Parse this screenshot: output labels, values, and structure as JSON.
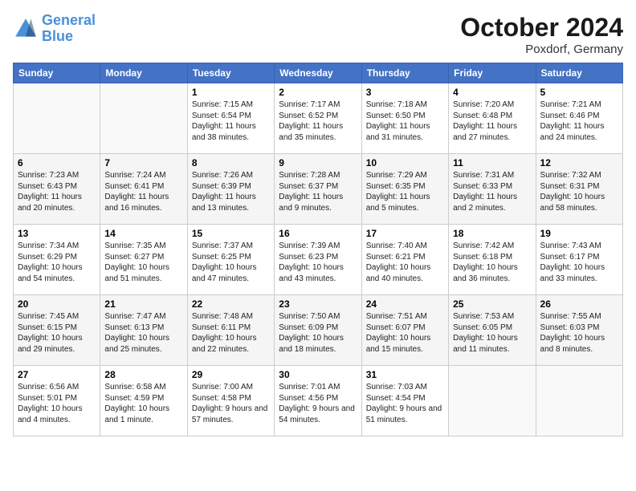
{
  "logo": {
    "line1": "General",
    "line2": "Blue"
  },
  "title": "October 2024",
  "subtitle": "Poxdorf, Germany",
  "days_of_week": [
    "Sunday",
    "Monday",
    "Tuesday",
    "Wednesday",
    "Thursday",
    "Friday",
    "Saturday"
  ],
  "weeks": [
    [
      {
        "day": "",
        "sunrise": "",
        "sunset": "",
        "daylight": ""
      },
      {
        "day": "",
        "sunrise": "",
        "sunset": "",
        "daylight": ""
      },
      {
        "day": "1",
        "sunrise": "Sunrise: 7:15 AM",
        "sunset": "Sunset: 6:54 PM",
        "daylight": "Daylight: 11 hours and 38 minutes."
      },
      {
        "day": "2",
        "sunrise": "Sunrise: 7:17 AM",
        "sunset": "Sunset: 6:52 PM",
        "daylight": "Daylight: 11 hours and 35 minutes."
      },
      {
        "day": "3",
        "sunrise": "Sunrise: 7:18 AM",
        "sunset": "Sunset: 6:50 PM",
        "daylight": "Daylight: 11 hours and 31 minutes."
      },
      {
        "day": "4",
        "sunrise": "Sunrise: 7:20 AM",
        "sunset": "Sunset: 6:48 PM",
        "daylight": "Daylight: 11 hours and 27 minutes."
      },
      {
        "day": "5",
        "sunrise": "Sunrise: 7:21 AM",
        "sunset": "Sunset: 6:46 PM",
        "daylight": "Daylight: 11 hours and 24 minutes."
      }
    ],
    [
      {
        "day": "6",
        "sunrise": "Sunrise: 7:23 AM",
        "sunset": "Sunset: 6:43 PM",
        "daylight": "Daylight: 11 hours and 20 minutes."
      },
      {
        "day": "7",
        "sunrise": "Sunrise: 7:24 AM",
        "sunset": "Sunset: 6:41 PM",
        "daylight": "Daylight: 11 hours and 16 minutes."
      },
      {
        "day": "8",
        "sunrise": "Sunrise: 7:26 AM",
        "sunset": "Sunset: 6:39 PM",
        "daylight": "Daylight: 11 hours and 13 minutes."
      },
      {
        "day": "9",
        "sunrise": "Sunrise: 7:28 AM",
        "sunset": "Sunset: 6:37 PM",
        "daylight": "Daylight: 11 hours and 9 minutes."
      },
      {
        "day": "10",
        "sunrise": "Sunrise: 7:29 AM",
        "sunset": "Sunset: 6:35 PM",
        "daylight": "Daylight: 11 hours and 5 minutes."
      },
      {
        "day": "11",
        "sunrise": "Sunrise: 7:31 AM",
        "sunset": "Sunset: 6:33 PM",
        "daylight": "Daylight: 11 hours and 2 minutes."
      },
      {
        "day": "12",
        "sunrise": "Sunrise: 7:32 AM",
        "sunset": "Sunset: 6:31 PM",
        "daylight": "Daylight: 10 hours and 58 minutes."
      }
    ],
    [
      {
        "day": "13",
        "sunrise": "Sunrise: 7:34 AM",
        "sunset": "Sunset: 6:29 PM",
        "daylight": "Daylight: 10 hours and 54 minutes."
      },
      {
        "day": "14",
        "sunrise": "Sunrise: 7:35 AM",
        "sunset": "Sunset: 6:27 PM",
        "daylight": "Daylight: 10 hours and 51 minutes."
      },
      {
        "day": "15",
        "sunrise": "Sunrise: 7:37 AM",
        "sunset": "Sunset: 6:25 PM",
        "daylight": "Daylight: 10 hours and 47 minutes."
      },
      {
        "day": "16",
        "sunrise": "Sunrise: 7:39 AM",
        "sunset": "Sunset: 6:23 PM",
        "daylight": "Daylight: 10 hours and 43 minutes."
      },
      {
        "day": "17",
        "sunrise": "Sunrise: 7:40 AM",
        "sunset": "Sunset: 6:21 PM",
        "daylight": "Daylight: 10 hours and 40 minutes."
      },
      {
        "day": "18",
        "sunrise": "Sunrise: 7:42 AM",
        "sunset": "Sunset: 6:18 PM",
        "daylight": "Daylight: 10 hours and 36 minutes."
      },
      {
        "day": "19",
        "sunrise": "Sunrise: 7:43 AM",
        "sunset": "Sunset: 6:17 PM",
        "daylight": "Daylight: 10 hours and 33 minutes."
      }
    ],
    [
      {
        "day": "20",
        "sunrise": "Sunrise: 7:45 AM",
        "sunset": "Sunset: 6:15 PM",
        "daylight": "Daylight: 10 hours and 29 minutes."
      },
      {
        "day": "21",
        "sunrise": "Sunrise: 7:47 AM",
        "sunset": "Sunset: 6:13 PM",
        "daylight": "Daylight: 10 hours and 25 minutes."
      },
      {
        "day": "22",
        "sunrise": "Sunrise: 7:48 AM",
        "sunset": "Sunset: 6:11 PM",
        "daylight": "Daylight: 10 hours and 22 minutes."
      },
      {
        "day": "23",
        "sunrise": "Sunrise: 7:50 AM",
        "sunset": "Sunset: 6:09 PM",
        "daylight": "Daylight: 10 hours and 18 minutes."
      },
      {
        "day": "24",
        "sunrise": "Sunrise: 7:51 AM",
        "sunset": "Sunset: 6:07 PM",
        "daylight": "Daylight: 10 hours and 15 minutes."
      },
      {
        "day": "25",
        "sunrise": "Sunrise: 7:53 AM",
        "sunset": "Sunset: 6:05 PM",
        "daylight": "Daylight: 10 hours and 11 minutes."
      },
      {
        "day": "26",
        "sunrise": "Sunrise: 7:55 AM",
        "sunset": "Sunset: 6:03 PM",
        "daylight": "Daylight: 10 hours and 8 minutes."
      }
    ],
    [
      {
        "day": "27",
        "sunrise": "Sunrise: 6:56 AM",
        "sunset": "Sunset: 5:01 PM",
        "daylight": "Daylight: 10 hours and 4 minutes."
      },
      {
        "day": "28",
        "sunrise": "Sunrise: 6:58 AM",
        "sunset": "Sunset: 4:59 PM",
        "daylight": "Daylight: 10 hours and 1 minute."
      },
      {
        "day": "29",
        "sunrise": "Sunrise: 7:00 AM",
        "sunset": "Sunset: 4:58 PM",
        "daylight": "Daylight: 9 hours and 57 minutes."
      },
      {
        "day": "30",
        "sunrise": "Sunrise: 7:01 AM",
        "sunset": "Sunset: 4:56 PM",
        "daylight": "Daylight: 9 hours and 54 minutes."
      },
      {
        "day": "31",
        "sunrise": "Sunrise: 7:03 AM",
        "sunset": "Sunset: 4:54 PM",
        "daylight": "Daylight: 9 hours and 51 minutes."
      },
      {
        "day": "",
        "sunrise": "",
        "sunset": "",
        "daylight": ""
      },
      {
        "day": "",
        "sunrise": "",
        "sunset": "",
        "daylight": ""
      }
    ]
  ]
}
